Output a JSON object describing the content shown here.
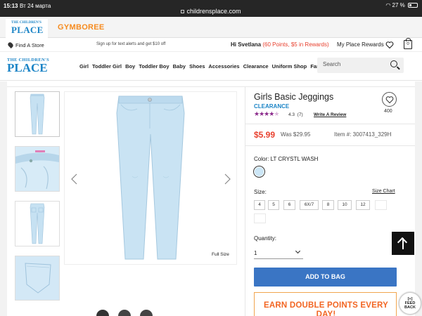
{
  "status_bar": {
    "time": "15:13",
    "date": "Вт 24 марта",
    "url": "childrensplace.com",
    "battery": "27 %",
    "battery_level": 0.27
  },
  "brand_tabs": {
    "tcp_line1": "THE CHILDREN'S",
    "tcp_line2": "PLACE",
    "gymboree": "GYMBOREE"
  },
  "utility": {
    "find_store": "Find A Store",
    "promo": "Sign up for text alerts and get $10 off",
    "greeting": "Hi Svetlana",
    "points": "(60 Points, $5 in Rewards)",
    "my_place_rewards": "My Place Rewards",
    "bag_count": "0"
  },
  "nav": {
    "logo_line1": "THE CHILDREN'S",
    "logo_line2": "PLACE",
    "links": [
      "Girl",
      "Toddler Girl",
      "Boy",
      "Toddler Boy",
      "Baby",
      "Shoes",
      "Accessories",
      "Clearance",
      "Uniform Shop",
      "Family Outfits"
    ],
    "search_placeholder": "Search"
  },
  "gallery": {
    "full_size": "Full Size",
    "thumbnail_count": 4
  },
  "product": {
    "title": "Girls Basic Jeggings",
    "badge": "CLEARANCE",
    "stars": "★★★★★",
    "rating_value": 4.3,
    "rating": "4.3",
    "review_count": "(7)",
    "write_review": "Write A Review",
    "favorites": "400",
    "price": "$5.99",
    "was_price": "Was $29.95",
    "item_number": "Item #: 3007413_329H",
    "color_label": "Color: LT CRYSTL WASH",
    "swatch_color": "#cce6f6",
    "size_label": "Size:",
    "size_chart": "Size Chart",
    "sizes": [
      {
        "label": "4",
        "available": true
      },
      {
        "label": "5",
        "available": true
      },
      {
        "label": "6",
        "available": true
      },
      {
        "label": "6X/7",
        "available": true
      },
      {
        "label": "8",
        "available": true
      },
      {
        "label": "10",
        "available": true
      },
      {
        "label": "12",
        "available": true
      },
      {
        "label": "",
        "available": false
      },
      {
        "label": "",
        "available": false
      }
    ],
    "quantity_label": "Quantity:",
    "quantity_value": "1",
    "add_to_bag": "ADD TO BAG",
    "promo_banner_line1": "EARN DOUBLE POINTS EVERY",
    "promo_banner_line2": "DAY!"
  },
  "feedback": {
    "line1": "[+]",
    "line2": "FEED",
    "line3": "BACK"
  },
  "colors": {
    "accent_blue": "#3a75c4",
    "brand_blue": "#1b84c6",
    "sale_red": "#e8402e",
    "promo_orange": "#f26522",
    "gymboree_orange": "#f68b1f",
    "stars_purple": "#8b2a8b"
  }
}
